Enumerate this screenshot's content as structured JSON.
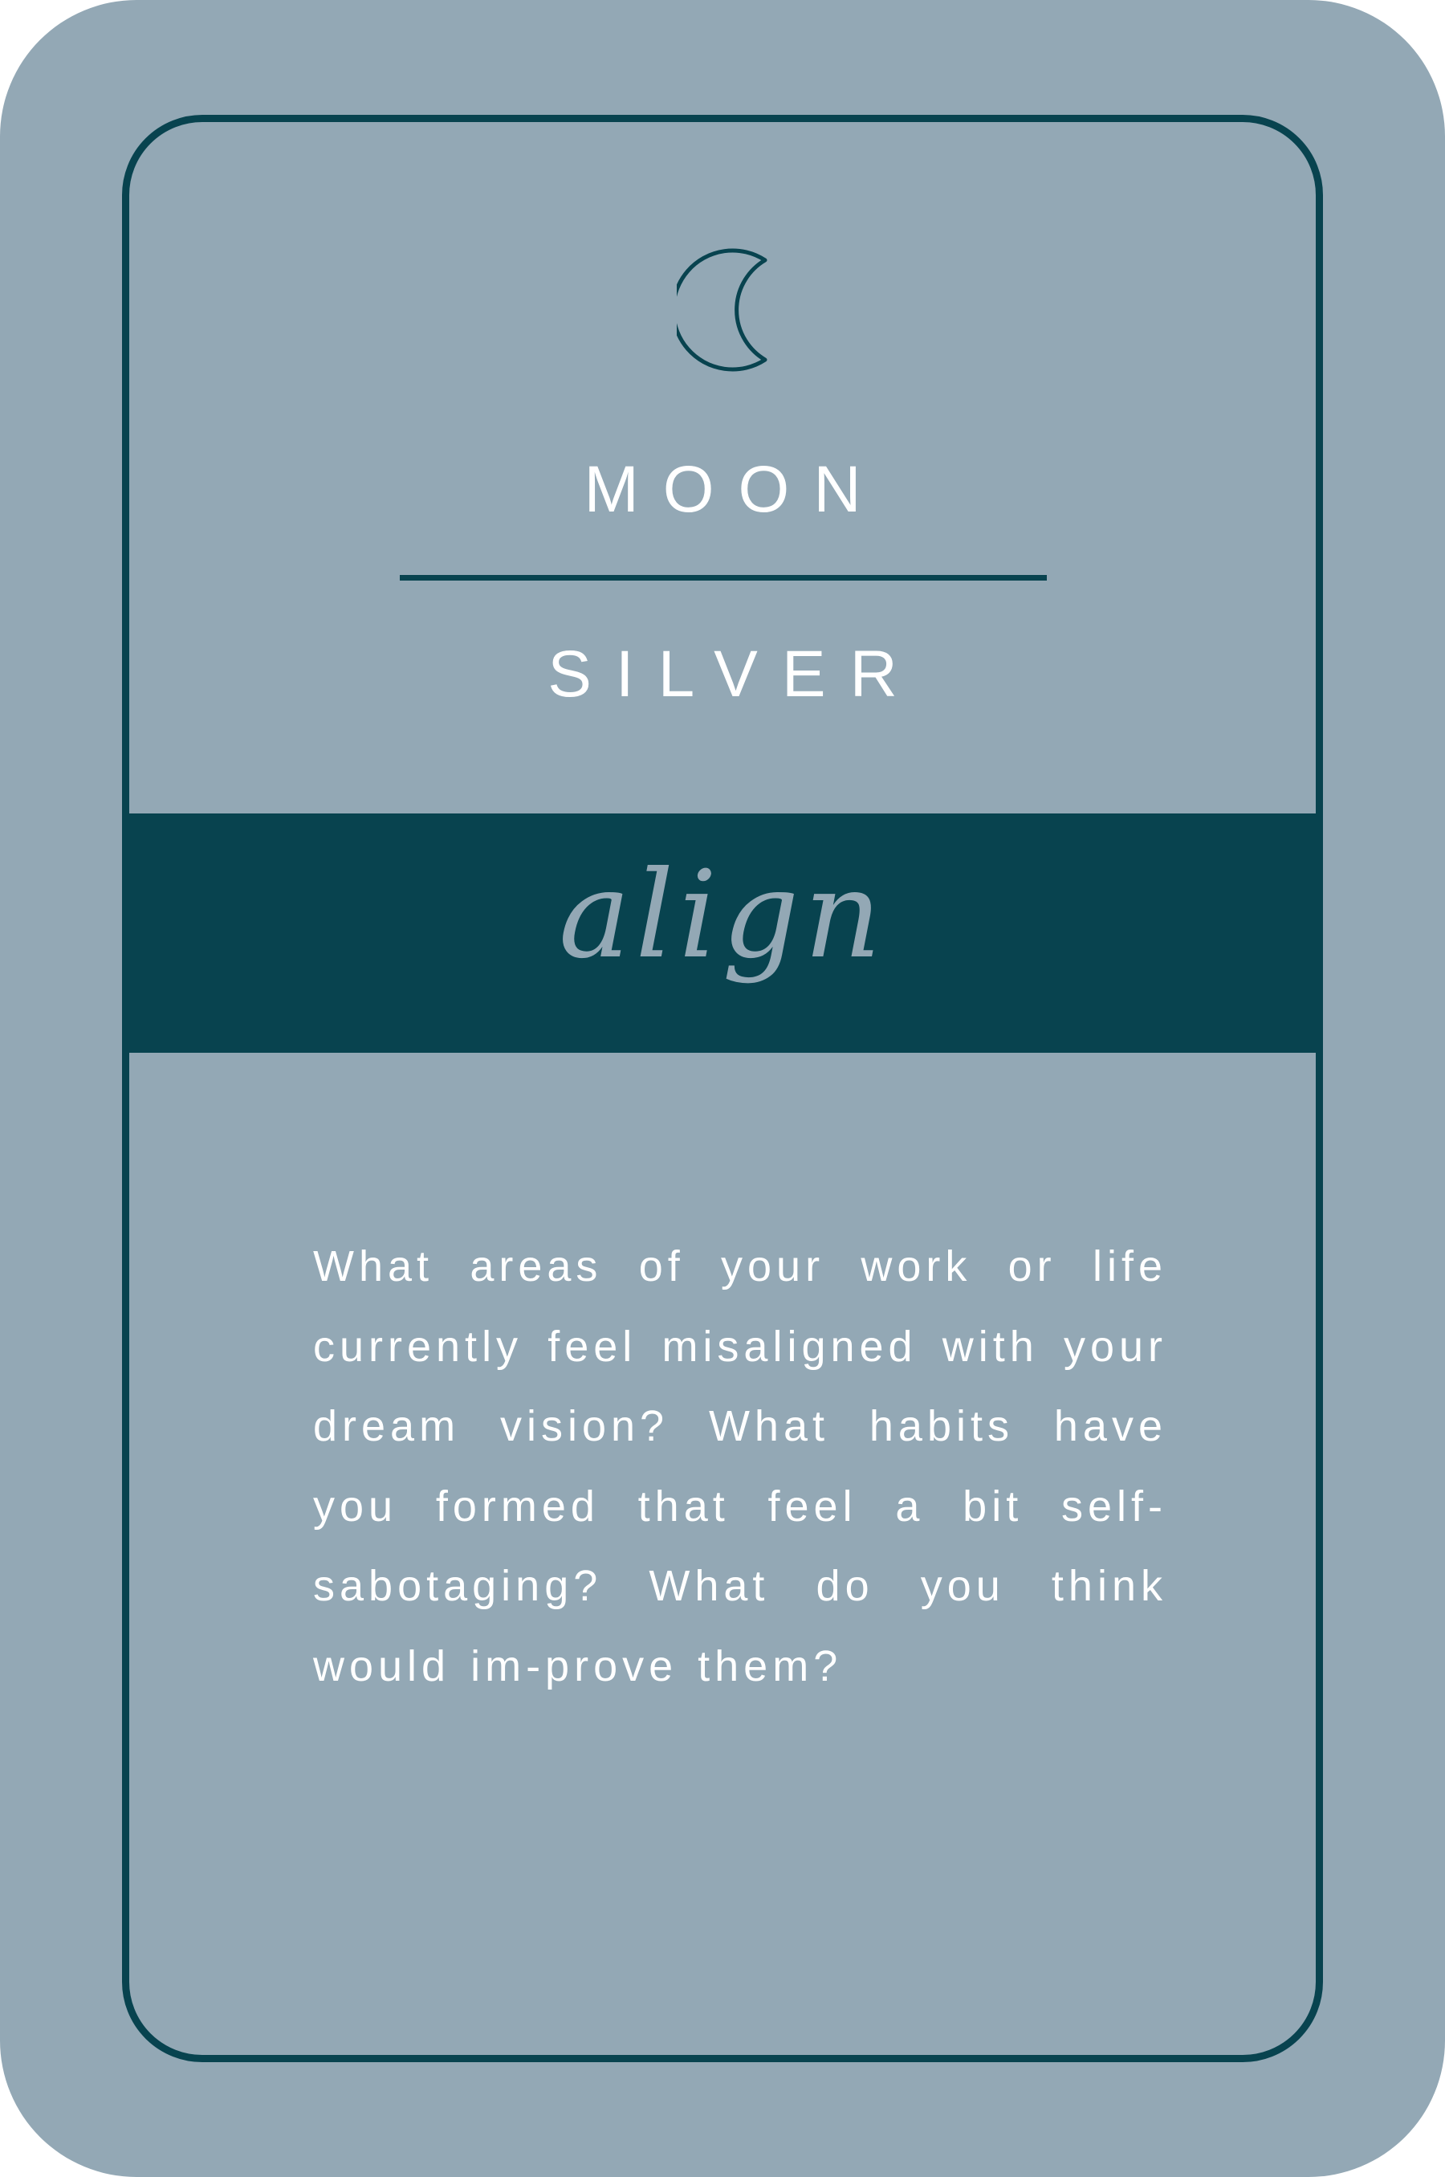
{
  "card": {
    "icon": "crescent-moon-icon",
    "title": "MOON",
    "subtitle": "SILVER",
    "theme_word": "align",
    "prompt": "What areas of your work or life currently feel misaligned with your dream vision? What habits have you formed that feel a bit self-sabotaging? What do you think would im-prove them?"
  },
  "colors": {
    "card_background": "#93a8b5",
    "accent": "#08434f",
    "text": "#ffffff"
  }
}
